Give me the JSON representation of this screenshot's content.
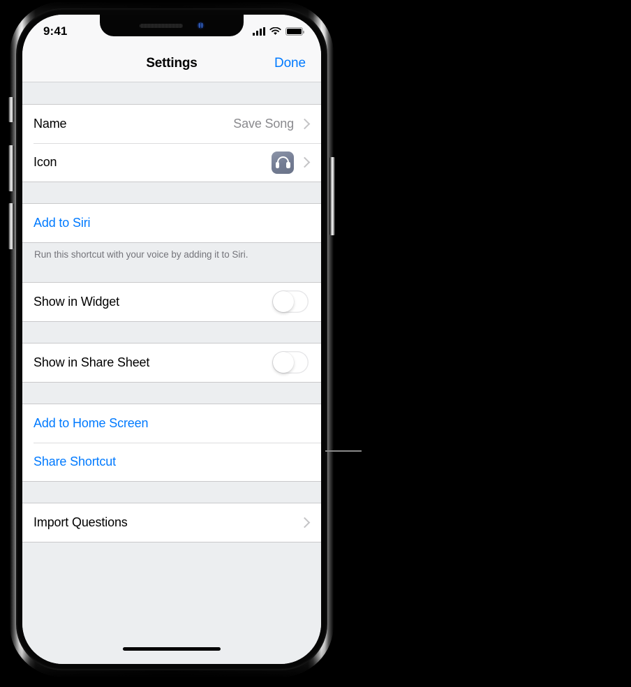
{
  "status_bar": {
    "time": "9:41",
    "cellular_icon": "cellular-bars-icon",
    "wifi_icon": "wifi-icon",
    "battery_icon": "battery-full-icon"
  },
  "nav_bar": {
    "title": "Settings",
    "done_label": "Done"
  },
  "colors": {
    "accent_blue": "#007aff",
    "group_background": "#eceef0",
    "row_background": "#ffffff",
    "separator": "#dcdcde",
    "secondary_text": "#8a8a8e",
    "footnote_text": "#74747a",
    "icon_tile": "#737c93"
  },
  "sections": [
    {
      "name": "details",
      "rows": [
        {
          "label": "Name",
          "value": "Save Song",
          "accessory": "chevron-right-icon"
        },
        {
          "label": "Icon",
          "value": "",
          "accessory": "chevron-right-icon",
          "icon": "headphones-icon"
        }
      ]
    },
    {
      "name": "siri",
      "rows": [
        {
          "label": "Add to Siri",
          "style": "link"
        }
      ],
      "footnote": "Run this shortcut with your voice by adding it to Siri."
    },
    {
      "name": "widget",
      "rows": [
        {
          "label": "Show in Widget",
          "accessory": "toggle",
          "toggle_on": false
        }
      ]
    },
    {
      "name": "share-sheet",
      "rows": [
        {
          "label": "Show in Share Sheet",
          "accessory": "toggle",
          "toggle_on": false
        }
      ]
    },
    {
      "name": "sharing",
      "rows": [
        {
          "label": "Add to Home Screen",
          "style": "link"
        },
        {
          "label": "Share Shortcut",
          "style": "link"
        }
      ]
    },
    {
      "name": "import",
      "rows": [
        {
          "label": "Import Questions",
          "accessory": "chevron-right-icon"
        }
      ]
    }
  ],
  "device": {
    "notch_speaker": "speaker-grille",
    "notch_camera": "front-camera",
    "home_indicator": "home-indicator",
    "buttons": [
      "silent-switch",
      "volume-up-button",
      "volume-down-button",
      "side-power-button"
    ]
  },
  "annotation": {
    "leader_line": "callout-leader-line"
  }
}
